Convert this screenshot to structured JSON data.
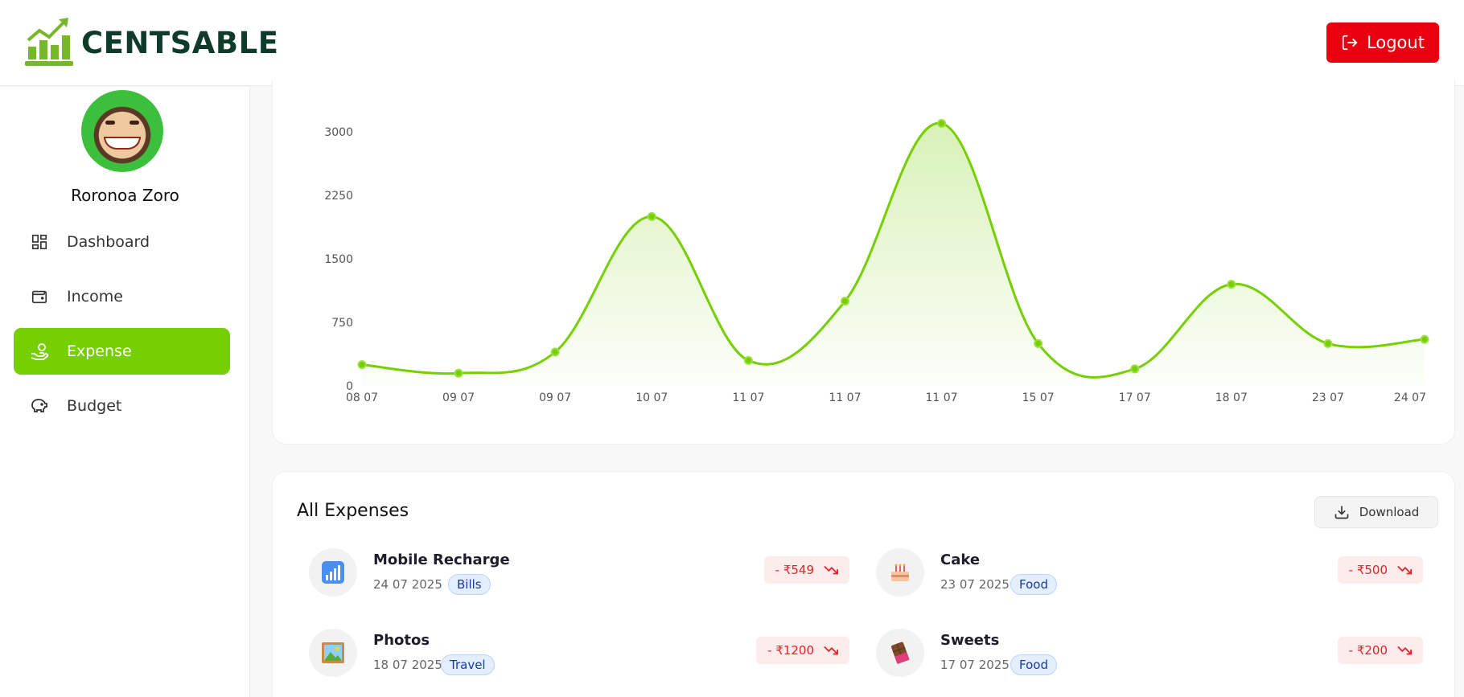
{
  "header": {
    "brand": "CENTSABLE",
    "logout_label": "Logout",
    "brand_color": "#76b82a",
    "logout_color": "#e8000f"
  },
  "sidebar": {
    "user_name": "Roronoa Zoro",
    "items": [
      {
        "label": "Dashboard",
        "icon": "dashboard-icon"
      },
      {
        "label": "Income",
        "icon": "wallet-icon"
      },
      {
        "label": "Expense",
        "icon": "hand-coins-icon",
        "active": true
      },
      {
        "label": "Budget",
        "icon": "piggy-bank-icon"
      }
    ],
    "active_color": "#76cf00"
  },
  "chart_data": {
    "type": "area",
    "categories": [
      "08 07",
      "09 07",
      "09 07",
      "10 07",
      "11 07",
      "11 07",
      "11 07",
      "15 07",
      "17 07",
      "18 07",
      "23 07",
      "24 07"
    ],
    "series": [
      {
        "values": [
          250,
          150,
          400,
          2000,
          300,
          1000,
          3100,
          500,
          200,
          1200,
          500,
          549
        ]
      }
    ],
    "y_ticks": [
      "0",
      "750",
      "1500",
      "2250",
      "3000"
    ],
    "ylim": [
      0,
      3000
    ],
    "grid": false,
    "line_color": "#76cf00"
  },
  "expenses": {
    "title": "All Expenses",
    "download_label": "Download",
    "items": [
      {
        "name": "Mobile Recharge",
        "date": "24 07 2025",
        "category": "Bills",
        "amount": "- ₹549",
        "icon": "signal-bars-icon"
      },
      {
        "name": "Cake",
        "date": "23 07 2025",
        "category": "Food",
        "amount": "- ₹500",
        "icon": "cake-icon"
      },
      {
        "name": "Photos",
        "date": "18 07 2025",
        "category": "Travel",
        "amount": "- ₹1200",
        "icon": "picture-icon"
      },
      {
        "name": "Sweets",
        "date": "17 07 2025",
        "category": "Food",
        "amount": "- ₹200",
        "icon": "chocolate-icon"
      }
    ]
  }
}
